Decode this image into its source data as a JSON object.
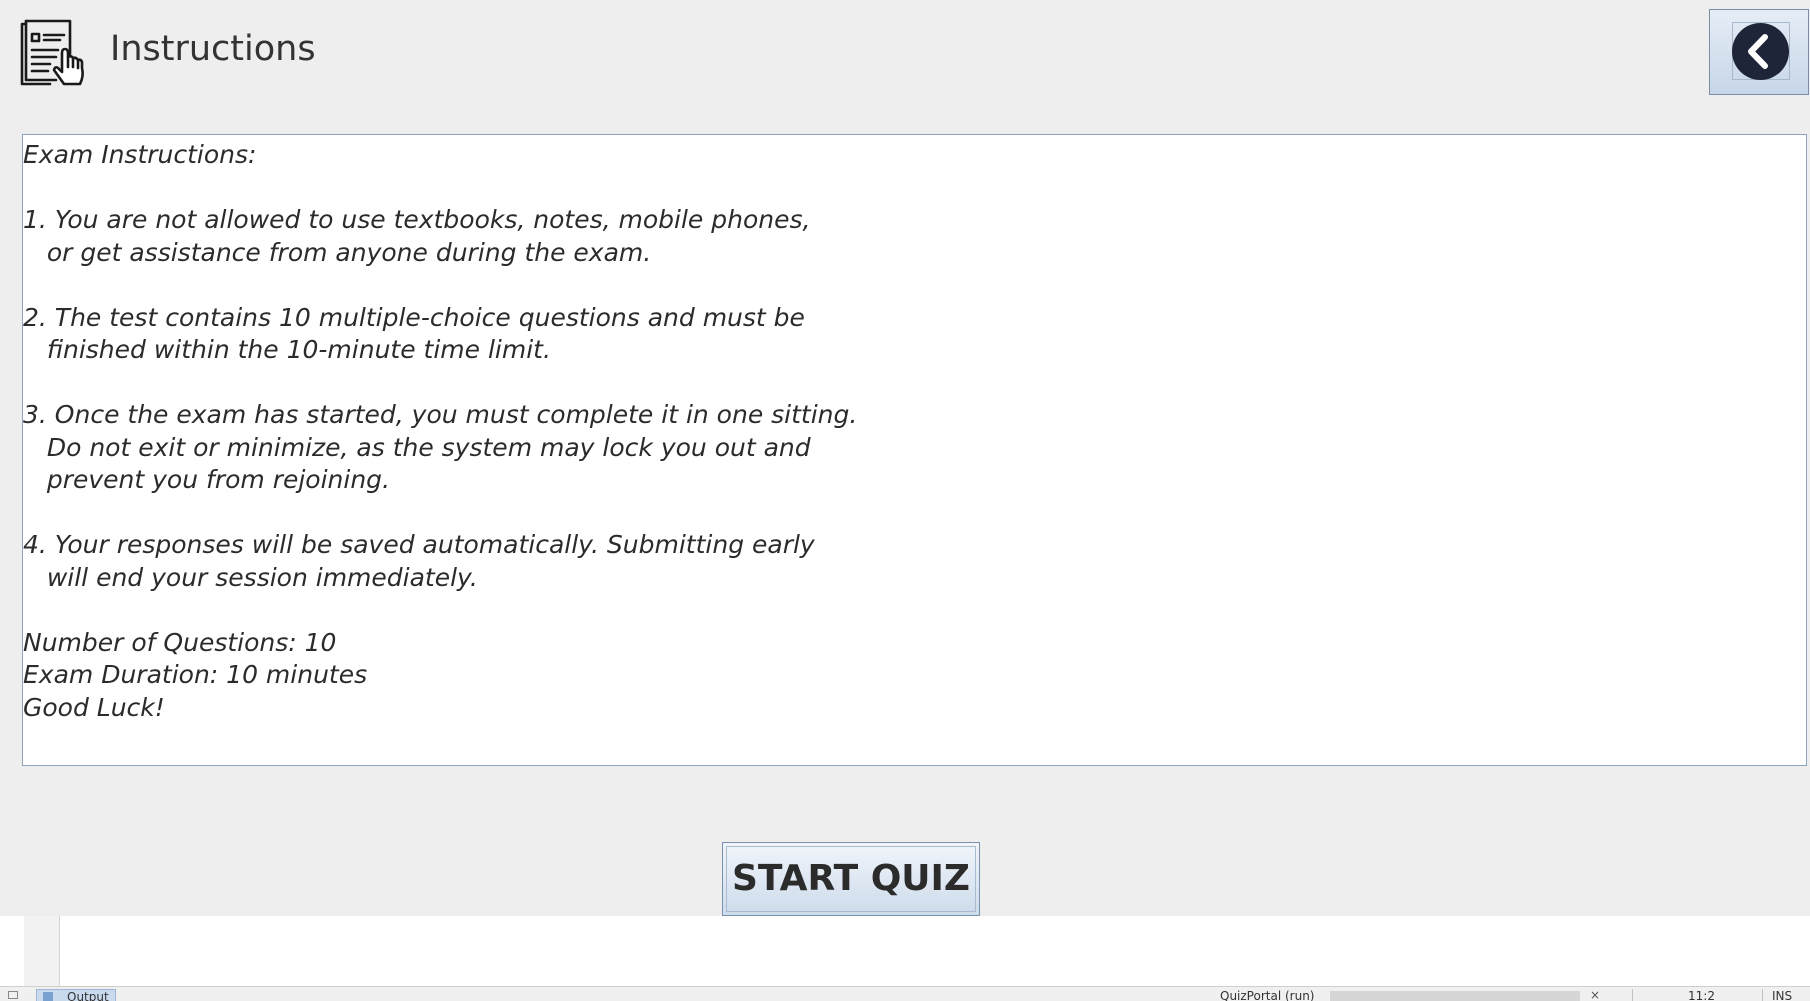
{
  "header": {
    "title": "Instructions",
    "icon": "document-pointer-icon",
    "back_icon": "chevron-left-icon"
  },
  "instructions": {
    "text": "Exam Instructions:\n\n1. You are not allowed to use textbooks, notes, mobile phones,\n   or get assistance from anyone during the exam.\n\n2. The test contains 10 multiple-choice questions and must be\n   finished within the 10-minute time limit.\n\n3. Once the exam has started, you must complete it in one sitting.\n   Do not exit or minimize, as the system may lock you out and\n   prevent you from rejoining.\n\n4. Your responses will be saved automatically. Submitting early\n   will end your session immediately.\n\nNumber of Questions: 10\nExam Duration: 10 minutes\nGood Luck!"
  },
  "actions": {
    "start_label": "START QUIZ"
  },
  "ide_status": {
    "output_tab": "Output",
    "project": "QuizPortal (run)",
    "close": "×",
    "position": "11:2",
    "mode": "INS"
  },
  "colors": {
    "background": "#eeeeee",
    "back_circle": "#1f2538",
    "button_gradient_top": "#f1f5fa",
    "button_gradient_bottom": "#cddbeb"
  }
}
